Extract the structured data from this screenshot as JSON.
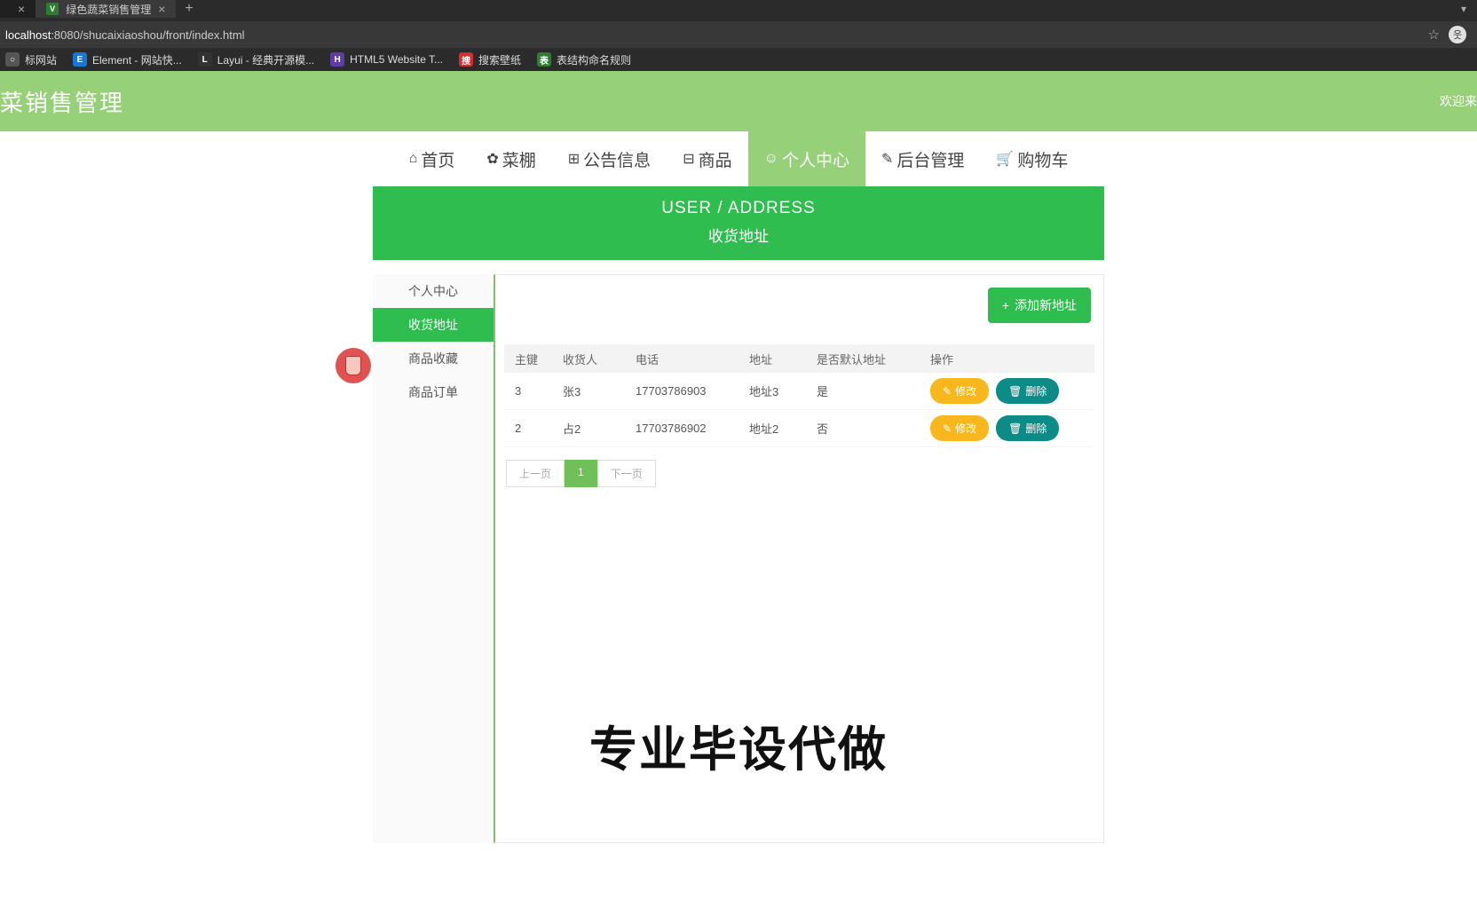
{
  "browser": {
    "tabs": [
      {
        "title": "",
        "active": false
      },
      {
        "title": "绿色蔬菜销售管理",
        "active": true
      }
    ],
    "url_host": "localhost",
    "url_port": ":8080",
    "url_path": "/shucaixiaoshou/front/index.html",
    "bookmarks": [
      {
        "label": "标网站"
      },
      {
        "label": "Element - 网站快..."
      },
      {
        "label": "Layui - 经典开源模..."
      },
      {
        "label": "HTML5 Website T..."
      },
      {
        "label": "搜索壁纸"
      },
      {
        "label": "表结构命名规则"
      }
    ]
  },
  "header": {
    "title": "菜销售管理",
    "welcome": "欢迎来"
  },
  "nav": [
    {
      "icon": "⌂",
      "label": "首页"
    },
    {
      "icon": "✿",
      "label": "菜棚"
    },
    {
      "icon": "⊞",
      "label": "公告信息"
    },
    {
      "icon": "⊟",
      "label": "商品"
    },
    {
      "icon": "☺",
      "label": "个人中心",
      "active": true
    },
    {
      "icon": "✎",
      "label": "后台管理"
    },
    {
      "icon": "🛒",
      "label": "购物车"
    }
  ],
  "banner": {
    "en": "USER / ADDRESS",
    "cn": "收货地址"
  },
  "sidebar": [
    {
      "label": "个人中心"
    },
    {
      "label": "收货地址",
      "active": true
    },
    {
      "label": "商品收藏"
    },
    {
      "label": "商品订单"
    }
  ],
  "add_button": "添加新地址",
  "table": {
    "headers": [
      "主键",
      "收货人",
      "电话",
      "地址",
      "是否默认地址",
      "操作"
    ],
    "rows": [
      {
        "id": "3",
        "name": "张3",
        "phone": "17703786903",
        "addr": "地址3",
        "def": "是"
      },
      {
        "id": "2",
        "name": "占2",
        "phone": "17703786902",
        "addr": "地址2",
        "def": "否"
      }
    ],
    "edit_label": "修改",
    "delete_label": "删除"
  },
  "pager": {
    "prev": "上一页",
    "page": "1",
    "next": "下一页"
  },
  "watermark": "专业毕设代做"
}
